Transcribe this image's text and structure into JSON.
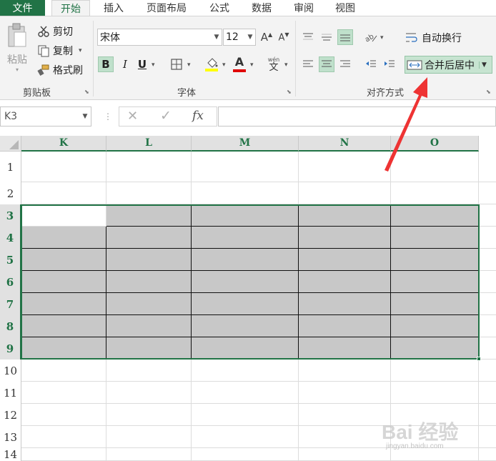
{
  "tabs": {
    "file": "文件",
    "items": [
      "开始",
      "插入",
      "页面布局",
      "公式",
      "数据",
      "审阅",
      "视图"
    ],
    "active": "开始"
  },
  "clipboard": {
    "paste": "粘贴",
    "cut": "剪切",
    "copy": "复制",
    "format_painter": "格式刷",
    "group_label": "剪贴板"
  },
  "font": {
    "name": "宋体",
    "size": "12",
    "bold": "B",
    "italic": "I",
    "underline": "U",
    "font_color_letter": "A",
    "phonetic": "wén",
    "phonetic_char": "文",
    "group_label": "字体",
    "grow_icon": "A",
    "shrink_icon": "A",
    "highlight_color": "#ffff00",
    "font_color": "#e00000"
  },
  "alignment": {
    "wrap_text": "自动换行",
    "merge_center": "合并后居中",
    "group_label": "对齐方式"
  },
  "formula_bar": {
    "name_box": "K3",
    "fx": "fx",
    "value": ""
  },
  "grid": {
    "columns": [
      "K",
      "L",
      "M",
      "N",
      "O"
    ],
    "rows": [
      "1",
      "2",
      "3",
      "4",
      "5",
      "6",
      "7",
      "8",
      "9",
      "10",
      "11",
      "12",
      "13",
      "14"
    ],
    "selected_rows": [
      "3",
      "4",
      "5",
      "6",
      "7",
      "8",
      "9"
    ],
    "active_cell": "K3",
    "selection_range": "K3:O9",
    "selection_fill": "#c8c8c8"
  },
  "watermark": {
    "text": "Bai 经验",
    "sub": "jingyan.baidu.com"
  },
  "colors": {
    "accent": "#217346",
    "annotation_arrow": "#ee3333"
  }
}
